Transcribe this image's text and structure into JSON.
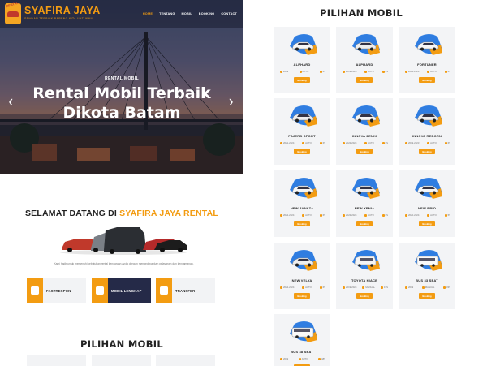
{
  "header": {
    "brand": "SYAFIRA JAYA",
    "brand_sub": "SEWAAN TERBAIK BARENG KITA UNTUKMU",
    "logo_tag": "RENTAL",
    "menu": [
      "HOME",
      "TENTANG",
      "MOBIL",
      "BOOKING",
      "CONTACT"
    ],
    "active_menu": "HOME"
  },
  "hero": {
    "small": "RENTAL MOBIL",
    "title_line1": "Rental Mobil Terbaik",
    "title_line2": "Dikota Batam",
    "prev_icon": "chevron-left-icon",
    "next_icon": "chevron-right-icon"
  },
  "welcome": {
    "prefix": "SELAMAT DATANG DI ",
    "highlight": "SYAFIRA JAYA RENTAL",
    "description": "Kami hadir untuk memenuhi kebutuhan rental kendaraan Anda dengan mengedepankan pelayanan dan kenyamanan."
  },
  "features": [
    {
      "label": "FASTRESPON",
      "icon": "chat-icon"
    },
    {
      "label": "MOBIL LENGKAP",
      "icon": "car-icon"
    },
    {
      "label": "TRANSFER",
      "icon": "transfer-icon"
    }
  ],
  "section_title": "PILIHAN MOBIL",
  "booking_label": "Booking",
  "colors": {
    "accent": "#f39c12",
    "navy": "#252a48",
    "blob": "#2f7de1"
  },
  "cars": [
    {
      "name": "ALPHARD",
      "year": "2019",
      "trans": "AUTO",
      "seats": "6S"
    },
    {
      "name": "ALPHARD",
      "year": "2019-2020",
      "trans": "AUTO",
      "seats": "6S"
    },
    {
      "name": "FORTUNER",
      "year": "2021-2023",
      "trans": "AUTO",
      "seats": "6S"
    },
    {
      "name": "PAJERO SPORT",
      "year": "2021-2024",
      "trans": "AUTO",
      "seats": "6S"
    },
    {
      "name": "INNOVA ZENIX",
      "year": "2022-2024",
      "trans": "AUTO",
      "seats": "6S"
    },
    {
      "name": "INNOVA REBORN",
      "year": "2019-2023",
      "trans": "AUTO",
      "seats": "6S"
    },
    {
      "name": "NEW AVANZA",
      "year": "2022-2024",
      "trans": "AUTO",
      "seats": "6S"
    },
    {
      "name": "NEW XENIA",
      "year": "2022-2024",
      "trans": "AUTO",
      "seats": "6S"
    },
    {
      "name": "NEW BRIO",
      "year": "2020-2024",
      "trans": "AUTO",
      "seats": "5S"
    },
    {
      "name": "NEW VELYA",
      "year": "2022-2024",
      "trans": "AUTO",
      "seats": "6S"
    },
    {
      "name": "TOYOTA HIACE",
      "year": "2019-2024",
      "trans": "MANUAL",
      "seats": "15S"
    },
    {
      "name": "BUS 33 SEAT",
      "year": "2019",
      "trans": "MANUAL",
      "seats": "33S"
    },
    {
      "name": "BUS 48 SEAT",
      "year": "2019",
      "trans": "AUTO",
      "seats": "48S"
    }
  ]
}
